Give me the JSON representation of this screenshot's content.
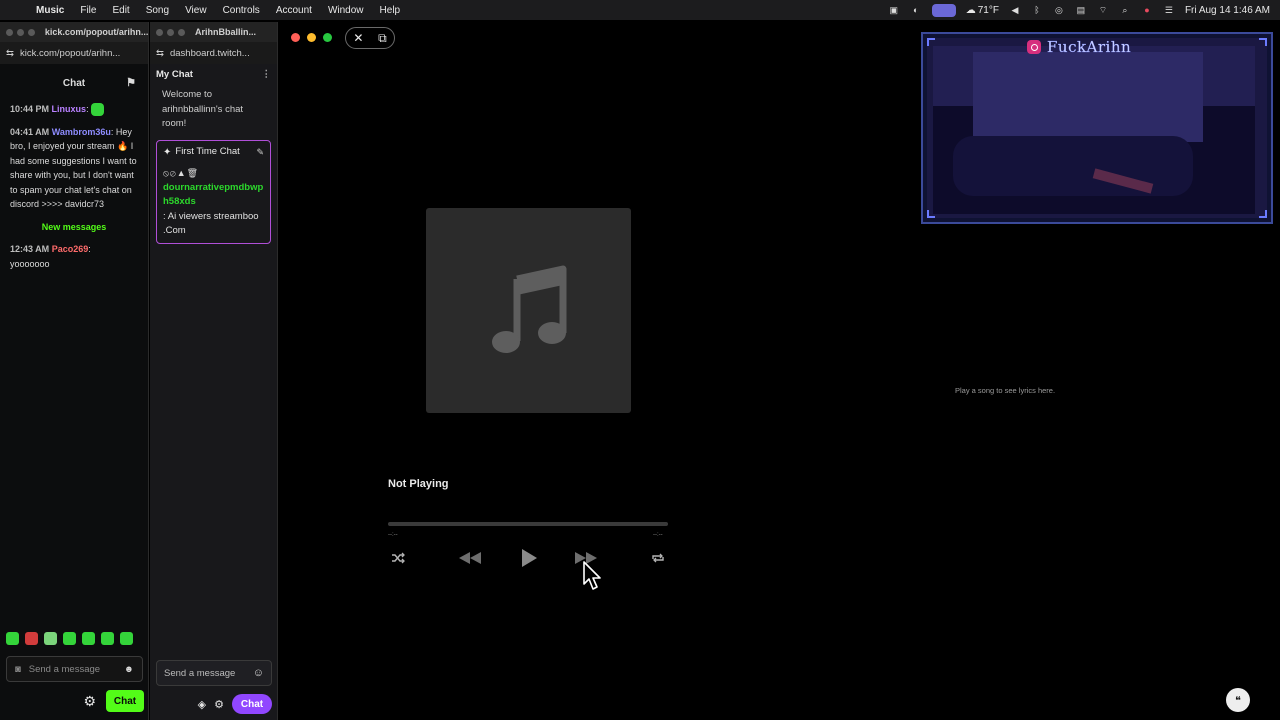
{
  "menubar": {
    "app_name": "Music",
    "items": [
      "File",
      "Edit",
      "Song",
      "View",
      "Controls",
      "Account",
      "Window",
      "Help"
    ],
    "weather": "71°F",
    "clock": "Fri Aug 14  1:46 AM"
  },
  "kick_window": {
    "url": "kick.com/popout/arihn...",
    "title": "kick.com/popout/arihn...",
    "chat_header": "Chat",
    "messages": [
      {
        "time": "10:44 PM",
        "user": "Linuxus",
        "sep": ":",
        "text": ""
      },
      {
        "time": "04:41 AM",
        "user": "Wambrom36u",
        "sep": ":",
        "text": "Hey bro, I enjoyed your stream 🔥 I had some suggestions I want to share with you, but I don't want to spam your chat let's chat on discord >>>> davidcr73"
      },
      {
        "time": "12:43 AM",
        "user": "Paco269",
        "sep": ":",
        "text": "yooooooo"
      }
    ],
    "new_messages": "New messages",
    "input_placeholder": "Send a message",
    "chat_button": "Chat"
  },
  "twitch_window": {
    "title": "ArihnBballin...",
    "url": "dashboard.twitch...",
    "my_chat": "My Chat",
    "welcome": "Welcome to arihnbballinn's chat room!",
    "first_time": {
      "label": "First Time Chat",
      "badges": "⦸⊘▲🗑",
      "user": "dournarrativepmdbwph58xds",
      "text": ": Ai viewers streamboo .Com"
    },
    "input_placeholder": "Send a message",
    "chat_button": "Chat"
  },
  "music": {
    "now_playing": "Not Playing",
    "time_elapsed": "--:--",
    "time_remaining": "--:--",
    "progress": 0,
    "lyrics_message": "Play a song to see lyrics here."
  },
  "overlay": {
    "handle": "FuckArihn"
  }
}
